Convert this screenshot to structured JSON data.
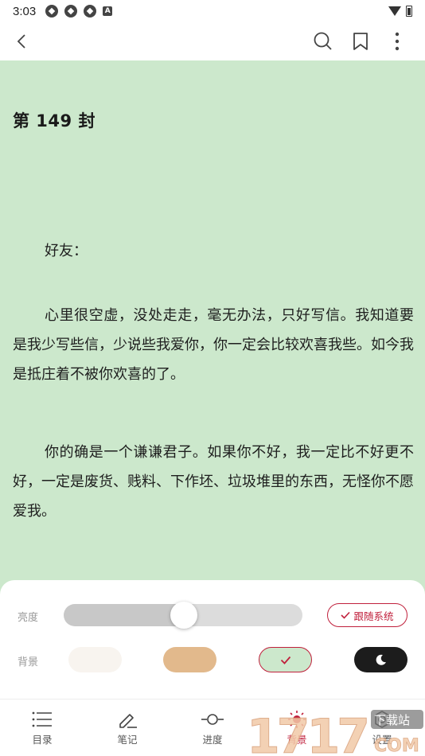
{
  "status_bar": {
    "time": "3:03",
    "a_badge": "A"
  },
  "reader": {
    "chapter_title": "第 149 封",
    "paragraphs": [
      "好友：",
      "心里很空虚，没处走走，毫无办法，只好写信。我知道要是我少写些信，少说些我爱你，你一定会比较欢喜我些。如今我是抵庄着不被你欢喜的了。",
      "你的确是一个谦谦君子。如果你不好，我一定比不好更不好，一定是废货、贱料、下作坯、垃圾堆里的东西，无怪你不愿爱我。"
    ]
  },
  "settings": {
    "brightness_label": "亮度",
    "brightness_level": 0.5,
    "follow_system_label": "跟随系统",
    "background_label": "背景",
    "backgrounds": [
      {
        "name": "white",
        "color": "#f8f4ef"
      },
      {
        "name": "tan",
        "color": "#e2b98c"
      },
      {
        "name": "green",
        "color": "#cce8cc",
        "selected": true
      },
      {
        "name": "night",
        "color": "#1c1c1c"
      }
    ]
  },
  "bottom_nav": [
    {
      "label": "目录",
      "icon": "list-icon"
    },
    {
      "label": "笔记",
      "icon": "pen-icon"
    },
    {
      "label": "进度",
      "icon": "progress-icon"
    },
    {
      "label": "背景",
      "icon": "sun-icon",
      "active": true
    },
    {
      "label": "设置",
      "icon": "gear-icon"
    }
  ],
  "watermark": {
    "text": "1717",
    "suffix": "下载站",
    "domain": "COM"
  },
  "colors": {
    "accent": "#c0203c",
    "reading_bg": "#cce8cc"
  }
}
